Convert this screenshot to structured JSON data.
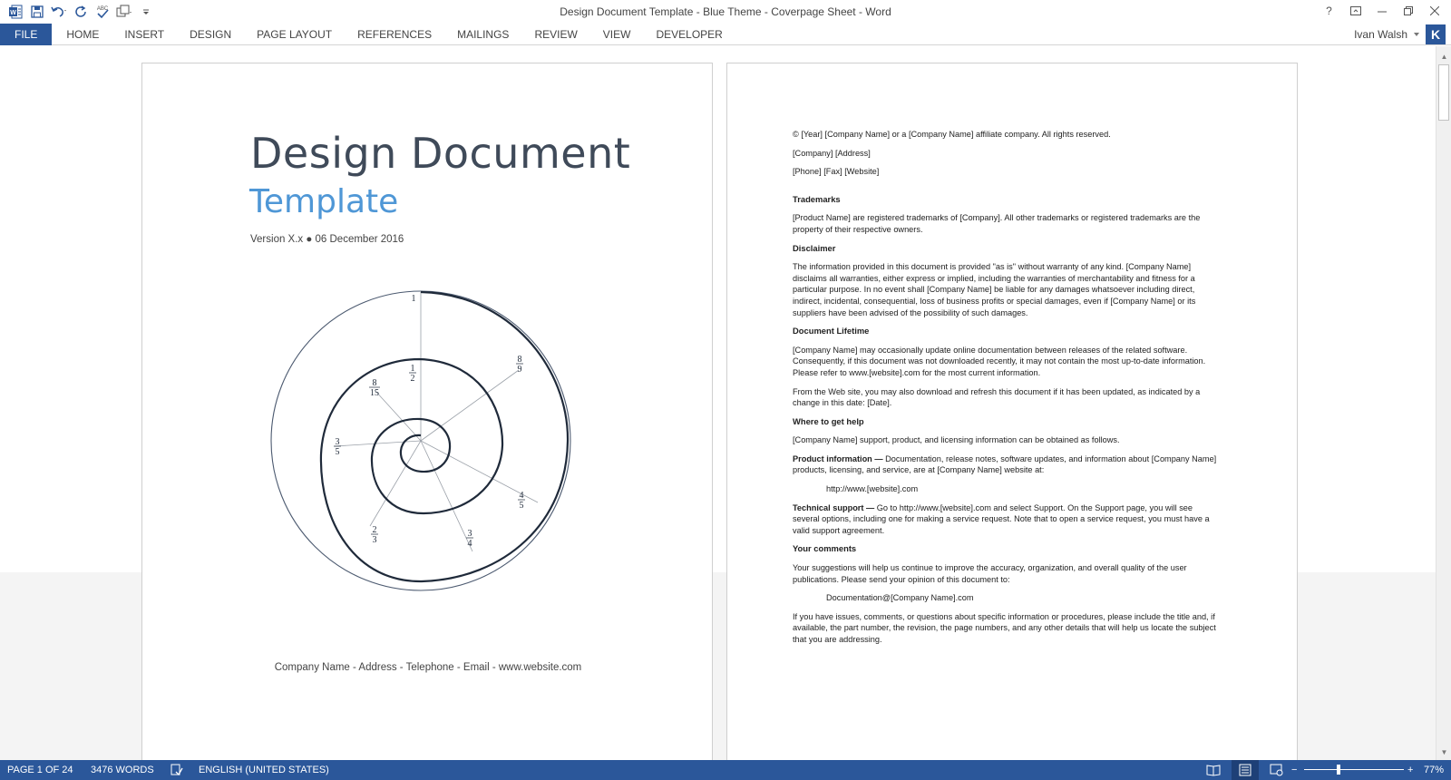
{
  "window": {
    "title": "Design Document Template - Blue Theme - Coverpage Sheet - Word"
  },
  "quick_access": {
    "icons": [
      "word-logo-icon",
      "save-icon",
      "undo-icon",
      "redo-icon",
      "spelling-check-icon",
      "touch-mode-icon",
      "customize-qat-icon"
    ],
    "spell_label": "ABC"
  },
  "window_controls": {
    "icons": [
      "help-icon",
      "ribbon-display-icon",
      "minimize-icon",
      "restore-icon",
      "close-icon"
    ],
    "help_label": "?"
  },
  "ribbon": {
    "tabs": [
      "FILE",
      "HOME",
      "INSERT",
      "DESIGN",
      "PAGE LAYOUT",
      "REFERENCES",
      "MAILINGS",
      "REVIEW",
      "VIEW",
      "DEVELOPER"
    ],
    "user_name": "Ivan Walsh",
    "avatar_initial": "K"
  },
  "page1": {
    "title": "Design Document",
    "subtitle": "Template",
    "version": "Version X.x ● 06 December 2016",
    "footer": "Company Name - Address - Telephone - Email - www.website.com",
    "spiral_labels": {
      "l1": "1",
      "l2n": "1",
      "l2d": "2",
      "l3n": "8",
      "l3d": "9",
      "l4n": "8",
      "l4d": "15",
      "l5n": "3",
      "l5d": "5",
      "l6n": "4",
      "l6d": "5",
      "l7n": "2",
      "l7d": "3",
      "l8n": "3",
      "l8d": "4"
    }
  },
  "page2": {
    "copyright": "© [Year] [Company Name] or a [Company Name] affiliate company. All rights reserved.",
    "company_address": "[Company] [Address]",
    "contact": "[Phone] [Fax] [Website]",
    "trademarks_heading": "Trademarks",
    "trademarks_text": "[Product Name] are registered trademarks of [Company]. All other trademarks or registered trademarks are the property of their respective owners.",
    "disclaimer_heading": "Disclaimer",
    "disclaimer_text": "The information provided in this document is provided \"as is\" without warranty of any kind. [Company Name] disclaims all warranties, either express or implied, including the warranties of merchantability and fitness for a particular purpose. In no event shall [Company Name] be liable for any damages whatsoever including direct, indirect, incidental, consequential, loss of business profits or special damages, even if [Company Name] or its suppliers have been advised of the possibility of such damages.",
    "lifetime_heading": "Document Lifetime",
    "lifetime_text1": "[Company Name] may occasionally update online documentation between releases of the related software. Consequently, if this document was not downloaded recently, it may not contain the most up-to-date information. Please refer to www.[website].com for the most current information.",
    "lifetime_text2": "From the Web site, you may also download and refresh this document if it has been updated, as indicated by a change in this date: [Date].",
    "help_heading": "Where to get help",
    "help_text": "[Company Name] support, product, and licensing information can be obtained as follows.",
    "product_info_label": "Product information —",
    "product_info_text": " Documentation, release notes, software updates, and information about [Company Name] products, licensing, and service, are at [Company Name] website at:",
    "product_url": "http://www.[website].com",
    "tech_support_label": "Technical support —",
    "tech_support_text": " Go to http://www.[website].com and select Support. On the Support page, you will see several options, including one for making a service request. Note that to open a service request, you must have a valid support agreement.",
    "comments_heading": "Your comments",
    "comments_text": "Your suggestions will help us continue to improve the accuracy, organization, and overall quality of the user publications. Please send your opinion of this document to:",
    "comments_email": "Documentation@[Company Name].com",
    "closing_text": "If you have issues, comments, or questions about specific information or procedures, please include the title and, if available, the part number, the revision, the page numbers, and any other details that will help us locate the subject that you are addressing."
  },
  "statusbar": {
    "page": "PAGE 1 OF 24",
    "words": "3476 WORDS",
    "language": "ENGLISH (UNITED STATES)",
    "zoom_level": "77%",
    "zoom_minus": "−",
    "zoom_plus": "+",
    "view_icons": [
      "read-mode-icon",
      "print-layout-icon",
      "web-layout-icon"
    ]
  },
  "colors": {
    "accent": "#2b579a",
    "title_text": "#3f4a59",
    "subtitle_blue": "#4f97d6"
  }
}
